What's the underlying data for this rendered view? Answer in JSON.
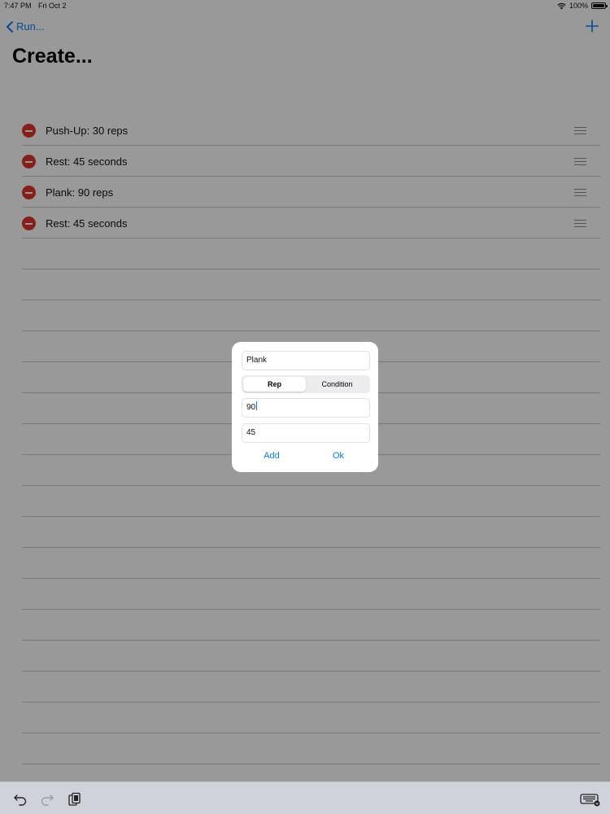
{
  "status_bar": {
    "time": "7:47 PM",
    "date": "Fri Oct 2",
    "battery": "100%"
  },
  "nav": {
    "back_label": "Run..."
  },
  "page_title": "Create...",
  "list": {
    "items": [
      {
        "label": "Push-Up: 30 reps"
      },
      {
        "label": "Rest: 45 seconds"
      },
      {
        "label": "Plank: 90 reps"
      },
      {
        "label": "Rest: 45 seconds"
      }
    ]
  },
  "dialog": {
    "name_value": "Plank",
    "segments": [
      "Rep",
      "Condition"
    ],
    "selected_segment": "Rep",
    "count_value": "90",
    "rest_value": "45",
    "add_label": "Add",
    "ok_label": "Ok"
  },
  "colors": {
    "accent": "#0a7aff",
    "delete": "#e0352b"
  },
  "icons": [
    "wifi-icon",
    "battery-icon",
    "chevron-left-icon",
    "plus-icon",
    "minus-circle-icon",
    "reorder-icon",
    "undo-icon",
    "redo-icon",
    "paste-icon",
    "keyboard-icon"
  ]
}
